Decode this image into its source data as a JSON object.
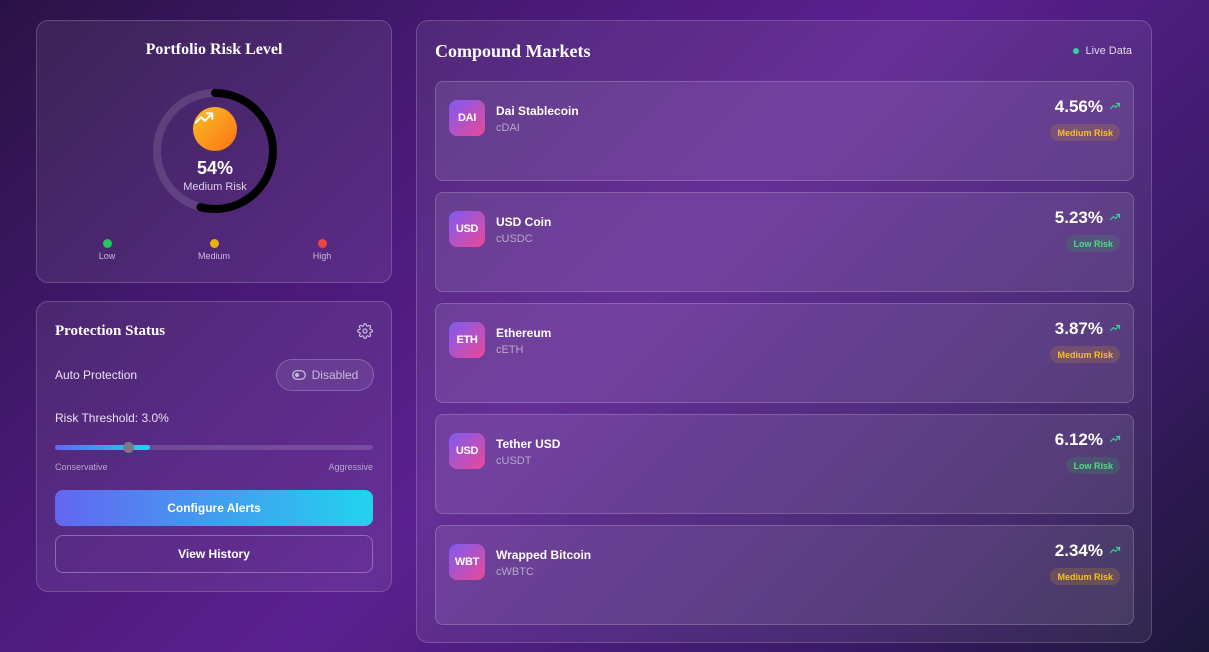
{
  "risk": {
    "title": "Portfolio Risk Level",
    "value_percent": 54,
    "value_text": "54%",
    "level_label": "Medium Risk",
    "badge_icon": "trending-up-icon",
    "legend": [
      {
        "label": "Low",
        "color": "#22c55e"
      },
      {
        "label": "Medium",
        "color": "#eab308"
      },
      {
        "label": "High",
        "color": "#ef4444"
      }
    ]
  },
  "protection": {
    "title": "Protection Status",
    "settings_icon": "gear-icon",
    "auto_label": "Auto Protection",
    "toggle_label": "Disabled",
    "threshold_label": "Risk Threshold: 3.0%",
    "slider_fraction": 0.23,
    "slider_fill_fraction": 0.3,
    "slider_min_label": "Conservative",
    "slider_max_label": "Aggressive",
    "configure_label": "Configure Alerts",
    "history_label": "View History"
  },
  "markets": {
    "title": "Compound Markets",
    "live_label": "Live Data",
    "items": [
      {
        "icon_text": "DAI",
        "name": "Dai Stablecoin",
        "symbol": "cDAI",
        "rate": "4.56%",
        "risk": "Medium Risk",
        "risk_level": "medium"
      },
      {
        "icon_text": "USD",
        "name": "USD Coin",
        "symbol": "cUSDC",
        "rate": "5.23%",
        "risk": "Low Risk",
        "risk_level": "low"
      },
      {
        "icon_text": "ETH",
        "name": "Ethereum",
        "symbol": "cETH",
        "rate": "3.87%",
        "risk": "Medium Risk",
        "risk_level": "medium"
      },
      {
        "icon_text": "USD",
        "name": "Tether USD",
        "symbol": "cUSDT",
        "rate": "6.12%",
        "risk": "Low Risk",
        "risk_level": "low"
      },
      {
        "icon_text": "WBT",
        "name": "Wrapped Bitcoin",
        "symbol": "cWBTC",
        "rate": "2.34%",
        "risk": "Medium Risk",
        "risk_level": "medium"
      }
    ]
  },
  "colors": {
    "accent_start": "#6366f1",
    "accent_end": "#22d3ee",
    "live_dot": "#34d399",
    "gauge_arc": "#000000"
  }
}
